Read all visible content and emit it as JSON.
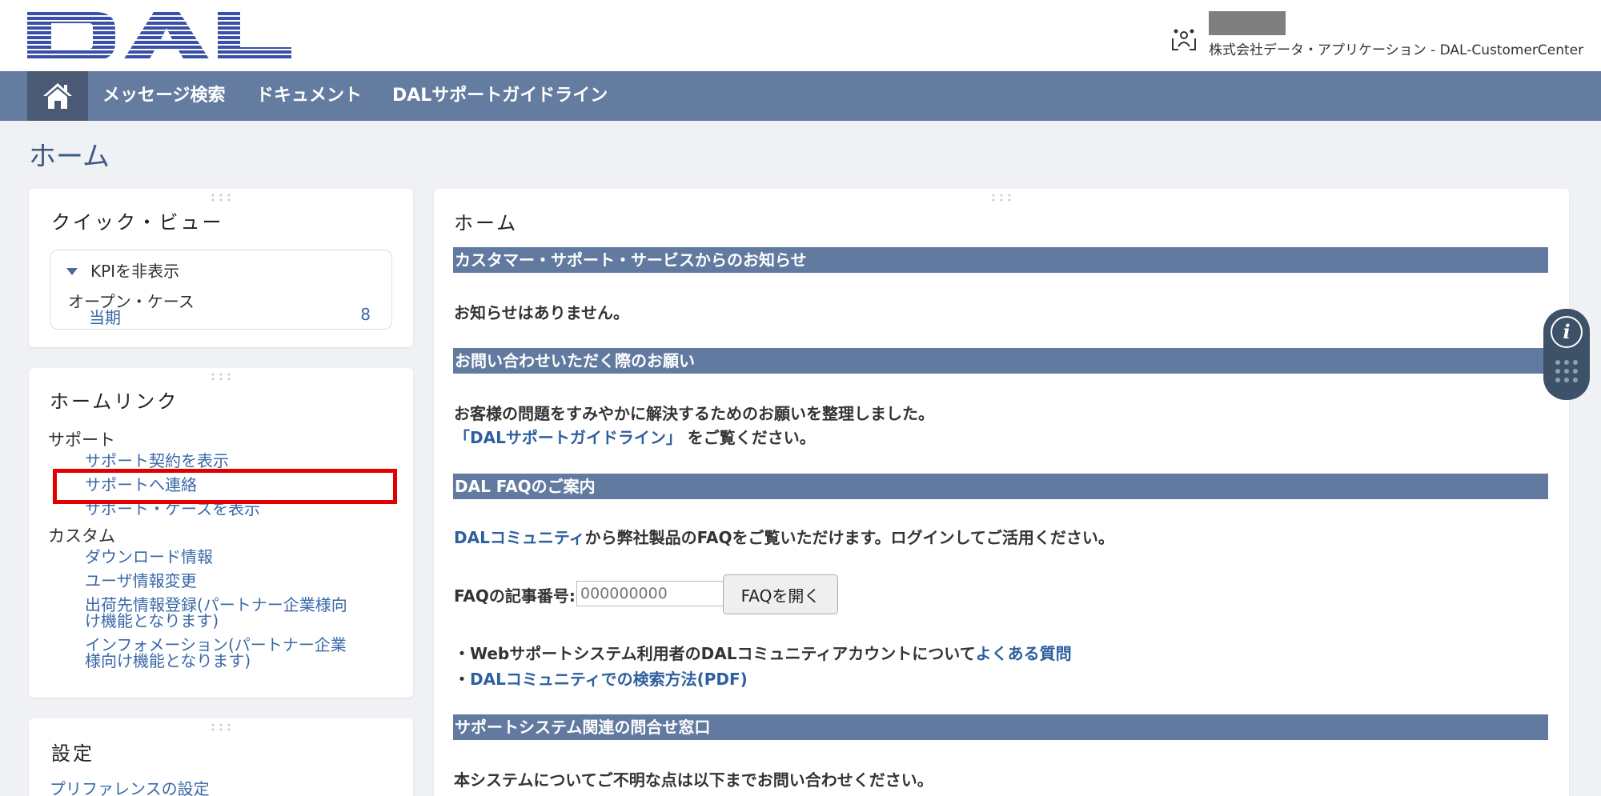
{
  "header": {
    "logo_text": "DAL",
    "user_org": "株式会社データ・アプリケーション - DAL-CustomerCenter"
  },
  "nav": {
    "items": [
      "メッセージ検索",
      "ドキュメント",
      "DALサポートガイドライン"
    ]
  },
  "page_title": "ホーム",
  "quick_view": {
    "title": "クイック・ビュー",
    "kpi_toggle": "KPIを非表示",
    "label": "オープン・ケース",
    "period": "当期",
    "count": "8"
  },
  "home_links": {
    "title": "ホームリンク",
    "support_label": "サポート",
    "support_items": [
      "サポート契約を表示",
      "サポートへ連絡",
      "サポート・ケースを表示"
    ],
    "custom_label": "カスタム",
    "custom_items": [
      "ダウンロード情報",
      "ユーザ情報変更",
      "出荷先情報登録(パートナー企業様向",
      "け機能となります)",
      "インフォメーション(パートナー企業",
      "様向け機能となります)"
    ]
  },
  "settings": {
    "title": "設定",
    "item": "プリファレンスの設定"
  },
  "main": {
    "heading": "ホーム",
    "sections": [
      {
        "title": "カスタマー・サポート・サービスからのお知らせ"
      },
      {
        "title": "お問い合わせいただく際のお願い"
      },
      {
        "title": "DAL FAQのご案内"
      },
      {
        "title": "サポートシステム関連の問合せ窓口"
      }
    ],
    "no_notice": "お知らせはありません。",
    "request_text": "お客様の問題をすみやかに解決するためのお願いを整理しました。",
    "guideline_link": "「DALサポートガイドライン」",
    "guideline_suffix": " をご覧ください。",
    "community_link": "DALコミュニティ",
    "community_suffix": "から弊社製品のFAQをご覧いただけます。ログインしてご活用ください。",
    "faq_label": "FAQの記事番号:",
    "faq_placeholder": "000000000",
    "faq_button": "FAQを開く",
    "bullet1_prefix": "・Webサポートシステム利用者のDALコミュニティアカウントについて",
    "bullet1_link": "よくある質問",
    "bullet2_prefix": "・",
    "bullet2_link": "DALコミュニティでの検索方法(PDF)",
    "contact_text": "本システムについてご不明な点は以下までお問い合わせください。"
  },
  "colors": {
    "nav_bg": "#647ca0",
    "section_bar": "#627aa0",
    "link": "#3a68a8",
    "highlight": "#e00000",
    "logo": "#3a4fa8"
  }
}
